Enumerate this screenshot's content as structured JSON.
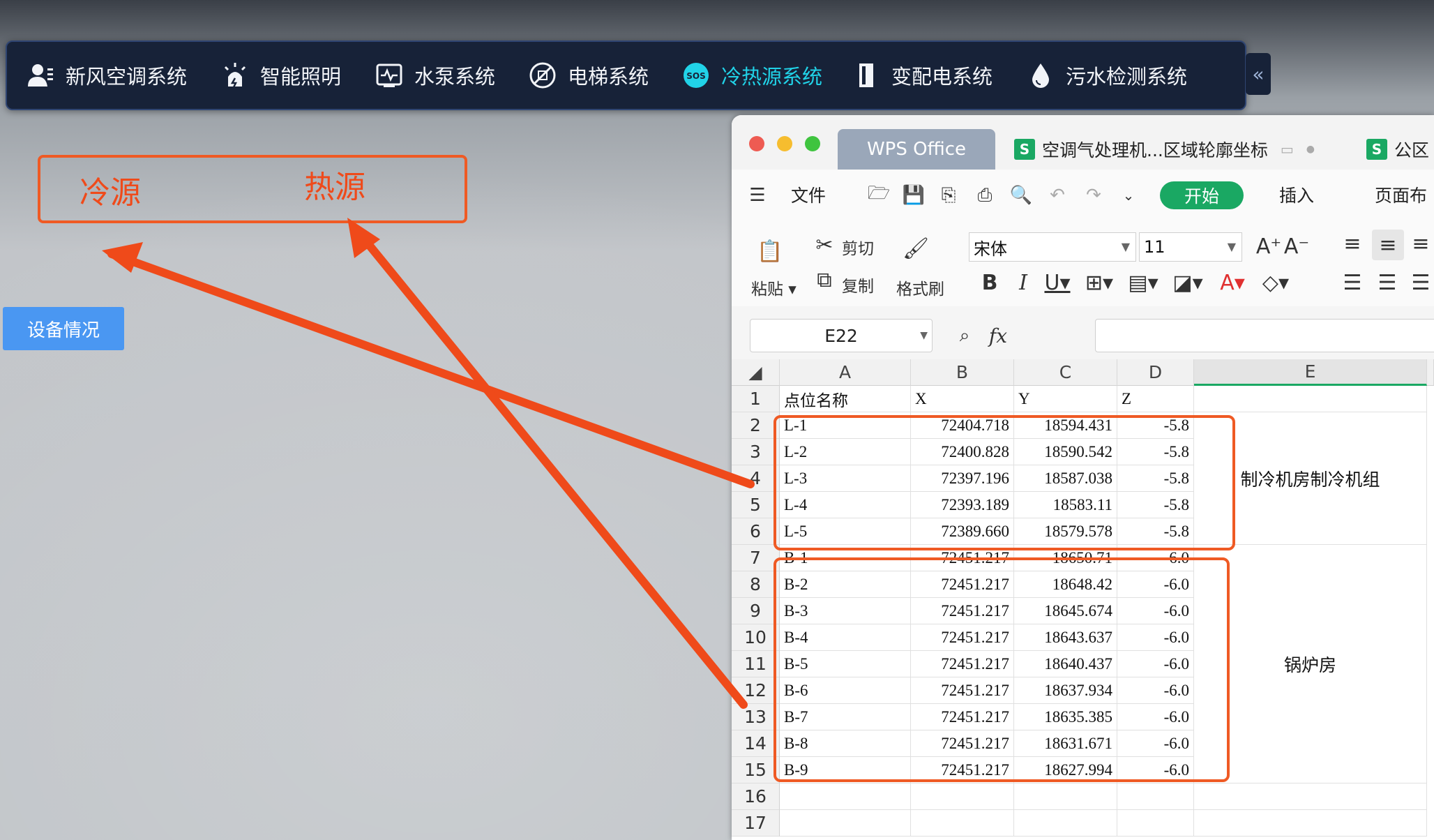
{
  "nav": {
    "items": [
      {
        "label": "新风空调系统",
        "icon": "user-settings-icon",
        "active": false
      },
      {
        "label": "智能照明",
        "icon": "light-bulb-icon",
        "active": false
      },
      {
        "label": "水泵系统",
        "icon": "monitor-pulse-icon",
        "active": false
      },
      {
        "label": "电梯系统",
        "icon": "elevator-icon",
        "active": false
      },
      {
        "label": "冷热源系统",
        "icon": "sos-icon",
        "active": true
      },
      {
        "label": "变配电系统",
        "icon": "power-cabinet-icon",
        "active": false
      },
      {
        "label": "污水检测系统",
        "icon": "water-drop-icon",
        "active": false
      }
    ],
    "collapse_glyph": "«",
    "active_color": "#21d3e8"
  },
  "annotation": {
    "cold_label": "冷源",
    "heat_label": "热源",
    "color": "#ef5a24"
  },
  "device_button": "设备情况",
  "wps": {
    "app_tab": "WPS Office",
    "doc_tab": "空调气处理机...区域轮廓坐标",
    "doc_tab2": "公区",
    "menu": {
      "file": "文件",
      "start": "开始",
      "insert": "插入",
      "page_layout": "页面布"
    },
    "toolbar": {
      "paste": "粘贴",
      "cut": "剪切",
      "copy": "复制",
      "format_painter": "格式刷",
      "font": "宋体",
      "font_size": "11"
    },
    "name_box": "E22",
    "fx": "fx",
    "columns": [
      "A",
      "B",
      "C",
      "D",
      "E"
    ],
    "rows": [
      {
        "n": "1",
        "a": "点位名称",
        "b": "X",
        "c": "Y",
        "d": "Z"
      },
      {
        "n": "2",
        "a": "L-1",
        "b": "72404.718",
        "c": "18594.431",
        "d": "-5.8"
      },
      {
        "n": "3",
        "a": "L-2",
        "b": "72400.828",
        "c": "18590.542",
        "d": "-5.8"
      },
      {
        "n": "4",
        "a": "L-3",
        "b": "72397.196",
        "c": "18587.038",
        "d": "-5.8"
      },
      {
        "n": "5",
        "a": "L-4",
        "b": "72393.189",
        "c": "18583.11",
        "d": "-5.8"
      },
      {
        "n": "6",
        "a": "L-5",
        "b": "72389.660",
        "c": "18579.578",
        "d": "-5.8"
      },
      {
        "n": "7",
        "a": "B-1",
        "b": "72451.217",
        "c": "18650.71",
        "d": "-6.0"
      },
      {
        "n": "8",
        "a": "B-2",
        "b": "72451.217",
        "c": "18648.42",
        "d": "-6.0"
      },
      {
        "n": "9",
        "a": "B-3",
        "b": "72451.217",
        "c": "18645.674",
        "d": "-6.0"
      },
      {
        "n": "10",
        "a": "B-4",
        "b": "72451.217",
        "c": "18643.637",
        "d": "-6.0"
      },
      {
        "n": "11",
        "a": "B-5",
        "b": "72451.217",
        "c": "18640.437",
        "d": "-6.0"
      },
      {
        "n": "12",
        "a": "B-6",
        "b": "72451.217",
        "c": "18637.934",
        "d": "-6.0"
      },
      {
        "n": "13",
        "a": "B-7",
        "b": "72451.217",
        "c": "18635.385",
        "d": "-6.0"
      },
      {
        "n": "14",
        "a": "B-8",
        "b": "72451.217",
        "c": "18631.671",
        "d": "-6.0"
      },
      {
        "n": "15",
        "a": "B-9",
        "b": "72451.217",
        "c": "18627.994",
        "d": "-6.0"
      },
      {
        "n": "16",
        "a": "",
        "b": "",
        "c": "",
        "d": ""
      },
      {
        "n": "17",
        "a": "",
        "b": "",
        "c": "",
        "d": ""
      }
    ],
    "merged_e": {
      "cold": "制冷机房制冷机组",
      "heat": "锅炉房"
    },
    "accent": "#1aa863"
  }
}
